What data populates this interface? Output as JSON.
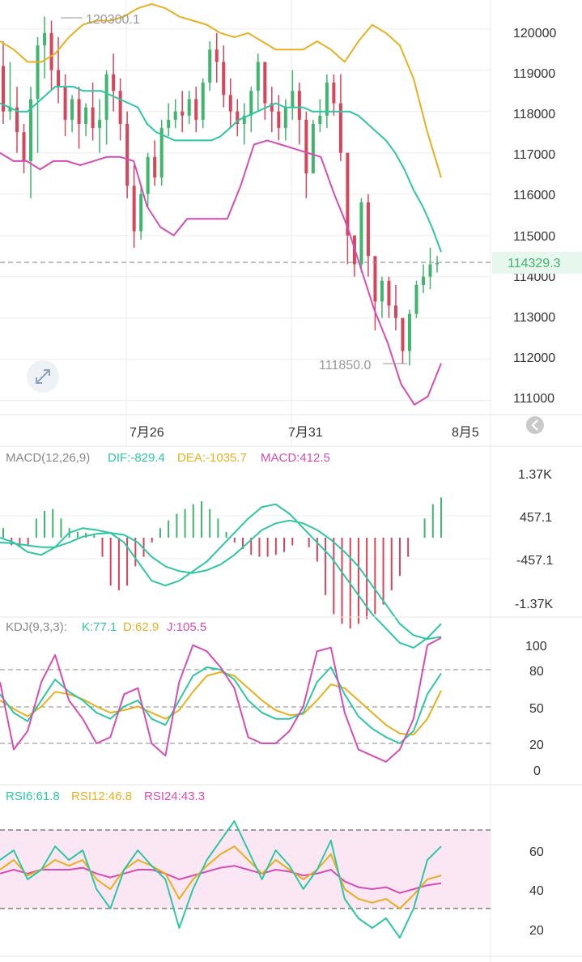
{
  "colors": {
    "up": "#3fb56d",
    "down": "#d6455a",
    "ma_fast": "#2fc6a3",
    "ma_slow": "#e6b020",
    "ma_third": "#d54db4",
    "current_price_bg": "#e8f7ee",
    "current_price_text": "#3fb56d",
    "rsi_band": "#fbe7f4"
  },
  "main": {
    "y_ticks": [
      "120000",
      "119000",
      "118000",
      "117000",
      "116000",
      "115000",
      "114000",
      "113000",
      "112000",
      "111000"
    ],
    "current_price": "114329.3",
    "high_label": "120300.1",
    "low_label": "111850.0",
    "x_ticks": [
      "7月26",
      "7月31",
      "8月5"
    ],
    "scroll_icon": "chevron-left-icon",
    "expand_icon": "expand-icon"
  },
  "macd": {
    "title": "MACD(12,26,9)",
    "dif_label": "DIF:-829.4",
    "dea_label": "DEA:-1035.7",
    "macd_label": "MACD:412.5",
    "y_ticks": [
      "1.37K",
      "457.1",
      "-457.1",
      "-1.37K"
    ]
  },
  "kdj": {
    "title": "KDJ(9,3,3):",
    "k_label": "K:77.1",
    "d_label": "D:62.9",
    "j_label": "J:105.5",
    "y_ticks": [
      "100",
      "80",
      "50",
      "20",
      "0"
    ]
  },
  "rsi": {
    "rsi6_label": "RSI6:61.8",
    "rsi12_label": "RSI12:46.8",
    "rsi24_label": "RSI24:43.3",
    "y_ticks": [
      "60",
      "40",
      "20"
    ]
  },
  "chart_data": {
    "type": "candlestick",
    "price_range": [
      110700,
      120700
    ],
    "candles": [
      [
        119100,
        119700,
        118000,
        117700
      ],
      [
        118000,
        119200,
        118100,
        117800
      ],
      [
        118100,
        118600,
        117500,
        117000
      ],
      [
        117500,
        117700,
        116800,
        116500
      ],
      [
        116800,
        118600,
        118300,
        115900
      ],
      [
        118300,
        119800,
        119600,
        117000
      ],
      [
        119600,
        120300,
        119900,
        118800
      ],
      [
        119900,
        120200,
        119000,
        118500
      ],
      [
        119000,
        119800,
        118600,
        118200
      ],
      [
        118600,
        118900,
        117800,
        117400
      ],
      [
        117800,
        118400,
        118300,
        117500
      ],
      [
        118300,
        118600,
        117700,
        117100
      ],
      [
        117700,
        118200,
        118100,
        117400
      ],
      [
        118100,
        118700,
        117600,
        117300
      ],
      [
        117600,
        118300,
        117800,
        117000
      ],
      [
        117800,
        119000,
        118900,
        117200
      ],
      [
        118900,
        119400,
        118500,
        118000
      ],
      [
        118500,
        118800,
        117700,
        117300
      ],
      [
        117700,
        118000,
        116200,
        115900
      ],
      [
        116200,
        116700,
        115100,
        114700
      ],
      [
        115100,
        116200,
        116000,
        114900
      ],
      [
        116000,
        117000,
        116900,
        115700
      ],
      [
        116900,
        117300,
        116400,
        116200
      ],
      [
        116400,
        117800,
        117600,
        116200
      ],
      [
        117600,
        118200,
        117800,
        117400
      ],
      [
        117800,
        118300,
        118000,
        117600
      ],
      [
        118000,
        118500,
        117900,
        117500
      ],
      [
        117900,
        118500,
        118300,
        117700
      ],
      [
        118300,
        118600,
        117800,
        117500
      ],
      [
        117800,
        118800,
        118700,
        117600
      ],
      [
        118700,
        119700,
        119500,
        118500
      ],
      [
        119500,
        119900,
        119200,
        118700
      ],
      [
        119200,
        119600,
        118400,
        118100
      ],
      [
        118400,
        118800,
        118000,
        117600
      ],
      [
        118000,
        118300,
        117700,
        117400
      ],
      [
        117700,
        118200,
        117900,
        117200
      ],
      [
        117900,
        118600,
        118500,
        117500
      ],
      [
        118500,
        119400,
        119200,
        118000
      ],
      [
        119200,
        119200,
        118200,
        117800
      ],
      [
        118200,
        118600,
        118000,
        117500
      ],
      [
        118000,
        118400,
        117600,
        117300
      ],
      [
        117600,
        118300,
        118100,
        117300
      ],
      [
        118100,
        119000,
        118500,
        117800
      ],
      [
        118500,
        118700,
        117800,
        117200
      ],
      [
        117800,
        118000,
        116500,
        115900
      ],
      [
        116500,
        117800,
        117700,
        116500
      ],
      [
        117700,
        118300,
        117900,
        117500
      ],
      [
        117900,
        118900,
        118700,
        117600
      ],
      [
        118700,
        118900,
        118200,
        117900
      ],
      [
        118200,
        118900,
        117000,
        116800
      ],
      [
        117000,
        116900,
        115000,
        114300
      ],
      [
        115000,
        115000,
        114300,
        114000
      ],
      [
        114300,
        115900,
        115800,
        114100
      ],
      [
        115800,
        116000,
        114500,
        114000
      ],
      [
        114500,
        114200,
        113400,
        112700
      ],
      [
        113400,
        114000,
        113900,
        113000
      ],
      [
        113900,
        114000,
        113300,
        113000
      ],
      [
        113300,
        113800,
        113000,
        112700
      ],
      [
        113000,
        113000,
        112200,
        111900
      ],
      [
        112200,
        113200,
        113100,
        111850
      ],
      [
        113100,
        113900,
        113800,
        113000
      ],
      [
        113800,
        114300,
        114000,
        113600
      ],
      [
        114000,
        114700,
        114300,
        113700
      ],
      [
        114300,
        114500,
        114329,
        114100
      ]
    ],
    "ma_fast": [
      118200,
      118100,
      118000,
      118000,
      118200,
      118400,
      118600,
      118600,
      118600,
      118500,
      118500,
      118500,
      118400,
      118300,
      118200,
      118100,
      117700,
      117500,
      117400,
      117300,
      117300,
      117300,
      117300,
      117300,
      117400,
      117600,
      117800,
      117900,
      118000,
      118100,
      118200,
      118100,
      118100,
      118100,
      118000,
      118000,
      118000,
      118000,
      118000,
      117900,
      117700,
      117500,
      117300,
      117000,
      116600,
      116100,
      115700,
      115200,
      114600
    ],
    "ma_slow": [
      119700,
      119500,
      119200,
      119200,
      119400,
      119800,
      120100,
      120200,
      120200,
      120300,
      120500,
      120600,
      120500,
      120300,
      120200,
      120100,
      119900,
      119800,
      119900,
      119700,
      119500,
      119500,
      119500,
      119700,
      119500,
      119200,
      119700,
      120100,
      119900,
      119600,
      118800,
      117500,
      116400
    ],
    "ma_third": [
      117000,
      116800,
      116800,
      116600,
      116800,
      116800,
      116700,
      116800,
      116900,
      116900,
      116800,
      115700,
      115200,
      115000,
      115400,
      115400,
      115400,
      115400,
      116200,
      117200,
      117300,
      117200,
      117100,
      117000,
      116900,
      116000,
      115200,
      114200,
      113200,
      112400,
      111400,
      110900,
      111100,
      111900
    ],
    "macd_hist": [
      100,
      -80,
      -100,
      -90,
      200,
      280,
      300,
      200,
      100,
      60,
      50,
      30,
      -200,
      -500,
      -550,
      -500,
      -300,
      -200,
      -50,
      100,
      180,
      250,
      300,
      350,
      380,
      300,
      200,
      60,
      -50,
      -120,
      -180,
      -200,
      -200,
      -180,
      -150,
      -80,
      0,
      -100,
      -250,
      -600,
      -800,
      -900,
      -950,
      -900,
      -850,
      -800,
      -700,
      -550,
      -400,
      -200,
      0,
      200,
      350,
      420
    ],
    "dif": [
      0,
      -50,
      -150,
      -180,
      -100,
      50,
      100,
      80,
      50,
      -50,
      -250,
      -450,
      -500,
      -450,
      -350,
      -250,
      -100,
      50,
      200,
      320,
      350,
      250,
      100,
      -50,
      -200,
      -400,
      -600,
      -800,
      -950,
      -1100,
      -1150,
      -1050,
      -900
    ],
    "dea": [
      -50,
      -60,
      -80,
      -100,
      -100,
      -50,
      10,
      40,
      50,
      30,
      -50,
      -200,
      -300,
      -350,
      -370,
      -340,
      -280,
      -180,
      -50,
      80,
      150,
      180,
      150,
      80,
      -20,
      -150,
      -300,
      -500,
      -700,
      -900,
      -1020,
      -1060,
      -1035
    ],
    "kdj_k": [
      60,
      45,
      38,
      55,
      72,
      62,
      55,
      45,
      40,
      50,
      55,
      40,
      35,
      55,
      75,
      82,
      80,
      72,
      55,
      45,
      40,
      40,
      45,
      70,
      82,
      60,
      42,
      32,
      25,
      20,
      30,
      60,
      77
    ],
    "kdj_d": [
      55,
      48,
      42,
      50,
      62,
      60,
      56,
      50,
      45,
      47,
      50,
      45,
      40,
      47,
      62,
      75,
      78,
      75,
      65,
      55,
      47,
      43,
      44,
      55,
      68,
      65,
      55,
      45,
      35,
      28,
      27,
      40,
      63
    ],
    "kdj_j": [
      70,
      15,
      30,
      70,
      92,
      55,
      40,
      20,
      25,
      60,
      65,
      20,
      10,
      70,
      100,
      95,
      82,
      65,
      25,
      20,
      20,
      30,
      50,
      95,
      98,
      45,
      15,
      10,
      5,
      15,
      40,
      100,
      106
    ],
    "rsi6": [
      55,
      60,
      45,
      50,
      62,
      55,
      60,
      40,
      30,
      50,
      60,
      52,
      45,
      20,
      40,
      55,
      65,
      75,
      60,
      45,
      60,
      52,
      40,
      50,
      65,
      35,
      25,
      20,
      25,
      15,
      30,
      55,
      62
    ],
    "rsi12": [
      50,
      55,
      47,
      50,
      55,
      52,
      55,
      45,
      40,
      50,
      55,
      52,
      48,
      35,
      45,
      52,
      58,
      62,
      55,
      48,
      55,
      50,
      45,
      50,
      58,
      40,
      35,
      33,
      35,
      30,
      37,
      45,
      47
    ],
    "rsi24": [
      48,
      50,
      48,
      50,
      50,
      50,
      51,
      48,
      46,
      48,
      50,
      50,
      48,
      45,
      47,
      49,
      51,
      52,
      50,
      48,
      50,
      49,
      47,
      48,
      50,
      44,
      41,
      40,
      41,
      38,
      40,
      42,
      43
    ]
  }
}
